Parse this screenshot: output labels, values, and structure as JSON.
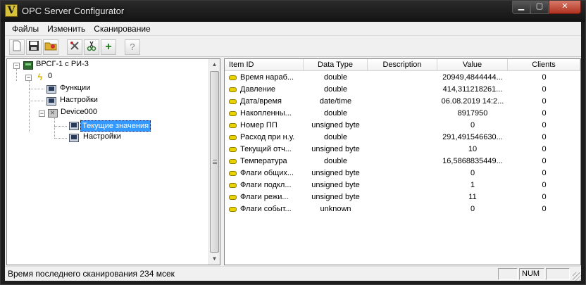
{
  "window": {
    "title": "OPC Server Configurator",
    "app_icon_glyph": "V",
    "minimize": "▁",
    "maximize": "▢",
    "close": "✕"
  },
  "menu": [
    {
      "label": "Файлы"
    },
    {
      "label": "Изменить"
    },
    {
      "label": "Сканирование"
    }
  ],
  "toolbar": {
    "icons": [
      "new-file-icon",
      "save-icon",
      "open-icon",
      "tools-icon",
      "cut-icon",
      "add-icon",
      "help-icon"
    ],
    "help_glyph": "?",
    "add_glyph": "+"
  },
  "tree": {
    "root": {
      "label": "ВРСГ-1 с РИ-3",
      "icon": "plc-icon"
    },
    "channel": {
      "label": "0",
      "icon": "bolt-icon"
    },
    "items": [
      {
        "label": "Функции",
        "icon": "monitor-icon"
      },
      {
        "label": "Настройки",
        "icon": "monitor-icon"
      }
    ],
    "device": {
      "label": "Device000",
      "icon": "device-icon"
    },
    "device_items": [
      {
        "label": "Текущие значения",
        "icon": "monitor-icon"
      },
      {
        "label": "Настройки",
        "icon": "monitor-icon"
      }
    ],
    "selected": "Текущие значения"
  },
  "table": {
    "columns": [
      "Item ID",
      "Data Type",
      "Description",
      "Value",
      "Clients"
    ],
    "rows": [
      {
        "id": "Время нараб...",
        "type": "double",
        "desc": "",
        "value": "20949,4844444...",
        "clients": "0"
      },
      {
        "id": "Давление",
        "type": "double",
        "desc": "",
        "value": "414,311218261...",
        "clients": "0"
      },
      {
        "id": "Дата/время",
        "type": "date/time",
        "desc": "",
        "value": "06.08.2019 14:2...",
        "clients": "0"
      },
      {
        "id": "Накопленны...",
        "type": "double",
        "desc": "",
        "value": "8917950",
        "clients": "0"
      },
      {
        "id": "Номер ПП",
        "type": "unsigned byte",
        "desc": "",
        "value": "0",
        "clients": "0"
      },
      {
        "id": "Расход при н.у.",
        "type": "double",
        "desc": "",
        "value": "291,491546630...",
        "clients": "0"
      },
      {
        "id": "Текущий отч...",
        "type": "unsigned byte",
        "desc": "",
        "value": "10",
        "clients": "0"
      },
      {
        "id": "Температура",
        "type": "double",
        "desc": "",
        "value": "16,5868835449...",
        "clients": "0"
      },
      {
        "id": "Флаги общих...",
        "type": "unsigned byte",
        "desc": "",
        "value": "0",
        "clients": "0"
      },
      {
        "id": "Флаги подкл...",
        "type": "unsigned byte",
        "desc": "",
        "value": "1",
        "clients": "0"
      },
      {
        "id": "Флаги режи...",
        "type": "unsigned byte",
        "desc": "",
        "value": "11",
        "clients": "0"
      },
      {
        "id": "Флаги событ...",
        "type": "unknown",
        "desc": "",
        "value": "0",
        "clients": "0"
      }
    ]
  },
  "status": {
    "text": "Время последнего сканирования 234 мсек",
    "pane_empty": "",
    "num": "NUM"
  },
  "colors": {
    "selection": "#3399ff",
    "item_pill": "#e8d200",
    "titlebar": "#1e1e1e",
    "close_button": "#c0392b"
  }
}
